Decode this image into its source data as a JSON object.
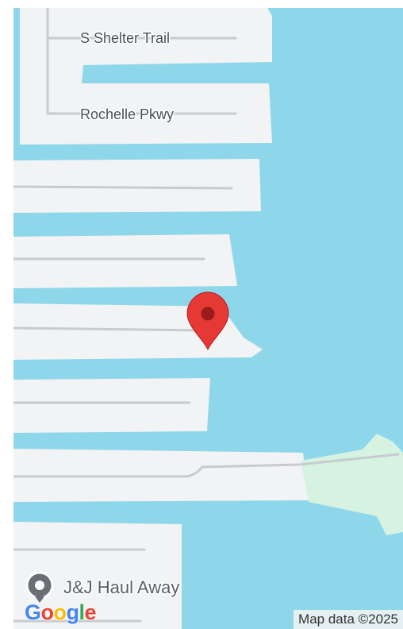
{
  "map": {
    "colors": {
      "water": "#8ed7ea",
      "land": "#f2f3f4",
      "park": "#d6f2e0",
      "road": "#c7cbd0",
      "marker": "#e53935",
      "marker_dot": "#9b1b1b"
    },
    "roads": [
      {
        "name": "S Shelter Trail"
      },
      {
        "name": "Rochelle Pkwy"
      }
    ],
    "place": {
      "name": "J&J Haul Away",
      "icon": "map-pin-icon"
    },
    "marker": {
      "icon": "location-marker-icon"
    },
    "branding": {
      "logo": "Google",
      "attribution": "Map data ©2025"
    }
  }
}
